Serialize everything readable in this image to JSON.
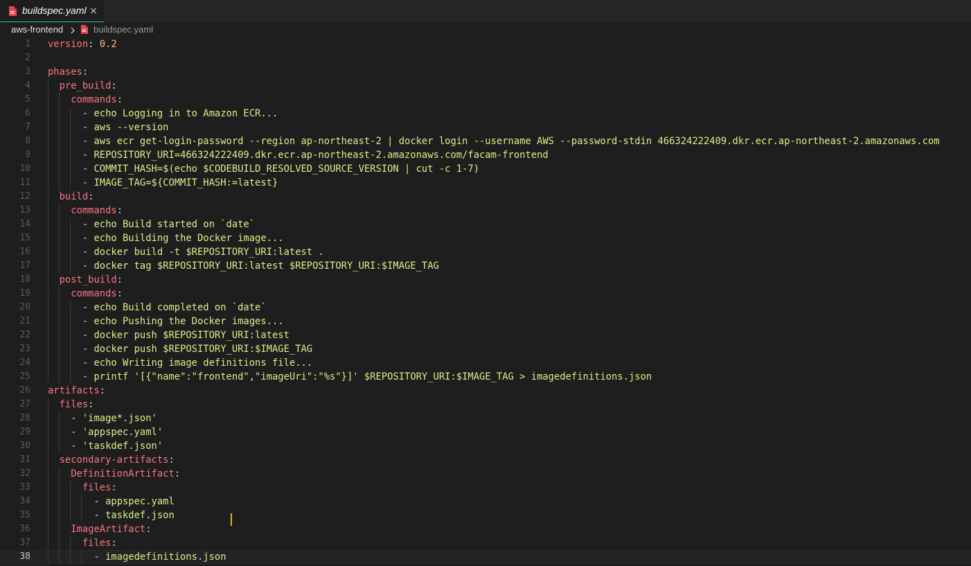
{
  "tab": {
    "label": "buildspec.yaml",
    "close_glyph": "×",
    "icon": "yaml-file-icon",
    "accent_color": "#2fb5ad"
  },
  "breadcrumb": {
    "folder": "aws-frontend",
    "separator_icon": "chevron-right-icon",
    "file_icon": "yaml-file-icon",
    "file": "buildspec.yaml"
  },
  "editor": {
    "current_line": 38,
    "colors": {
      "key": "#f97583",
      "value": "#d7f08a",
      "number": "#fab387",
      "cursor": "#f5a623"
    },
    "lines": [
      {
        "n": "1",
        "indent": "",
        "key": "version",
        "num": "0.2"
      },
      {
        "n": "2"
      },
      {
        "n": "3",
        "indent": "",
        "key": "phases"
      },
      {
        "n": "4",
        "indent": "  ",
        "key": "pre_build"
      },
      {
        "n": "5",
        "indent": "    ",
        "key": "commands"
      },
      {
        "n": "6",
        "indent": "      ",
        "dash": true,
        "value": "echo Logging in to Amazon ECR..."
      },
      {
        "n": "7",
        "indent": "      ",
        "dash": true,
        "value": "aws --version"
      },
      {
        "n": "8",
        "indent": "      ",
        "dash": true,
        "value": "aws ecr get-login-password --region ap-northeast-2 | docker login --username AWS --password-stdin 466324222409.dkr.ecr.ap-northeast-2.amazonaws.com"
      },
      {
        "n": "9",
        "indent": "      ",
        "dash": true,
        "value": "REPOSITORY_URI=466324222409.dkr.ecr.ap-northeast-2.amazonaws.com/facam-frontend"
      },
      {
        "n": "10",
        "indent": "      ",
        "dash": true,
        "value": "COMMIT_HASH=$(echo $CODEBUILD_RESOLVED_SOURCE_VERSION | cut -c 1-7)"
      },
      {
        "n": "11",
        "indent": "      ",
        "dash": true,
        "value": "IMAGE_TAG=${COMMIT_HASH:=latest}"
      },
      {
        "n": "12",
        "indent": "  ",
        "key": "build"
      },
      {
        "n": "13",
        "indent": "    ",
        "key": "commands"
      },
      {
        "n": "14",
        "indent": "      ",
        "dash": true,
        "value": "echo Build started on `date`"
      },
      {
        "n": "15",
        "indent": "      ",
        "dash": true,
        "value": "echo Building the Docker image..."
      },
      {
        "n": "16",
        "indent": "      ",
        "dash": true,
        "value": "docker build -t $REPOSITORY_URI:latest ."
      },
      {
        "n": "17",
        "indent": "      ",
        "dash": true,
        "value": "docker tag $REPOSITORY_URI:latest $REPOSITORY_URI:$IMAGE_TAG"
      },
      {
        "n": "18",
        "indent": "  ",
        "key": "post_build"
      },
      {
        "n": "19",
        "indent": "    ",
        "key": "commands"
      },
      {
        "n": "20",
        "indent": "      ",
        "dash": true,
        "value": "echo Build completed on `date`"
      },
      {
        "n": "21",
        "indent": "      ",
        "dash": true,
        "value": "echo Pushing the Docker images..."
      },
      {
        "n": "22",
        "indent": "      ",
        "dash": true,
        "value": "docker push $REPOSITORY_URI:latest"
      },
      {
        "n": "23",
        "indent": "      ",
        "dash": true,
        "value": "docker push $REPOSITORY_URI:$IMAGE_TAG"
      },
      {
        "n": "24",
        "indent": "      ",
        "dash": true,
        "value": "echo Writing image definitions file..."
      },
      {
        "n": "25",
        "indent": "      ",
        "dash": true,
        "value": "printf '[{\"name\":\"frontend\",\"imageUri\":\"%s\"}]' $REPOSITORY_URI:$IMAGE_TAG > imagedefinitions.json"
      },
      {
        "n": "26",
        "indent": "",
        "key": "artifacts"
      },
      {
        "n": "27",
        "indent": "  ",
        "key": "files"
      },
      {
        "n": "28",
        "indent": "    ",
        "dash": true,
        "value": "'image*.json'"
      },
      {
        "n": "29",
        "indent": "    ",
        "dash": true,
        "value": "'appspec.yaml'"
      },
      {
        "n": "30",
        "indent": "    ",
        "dash": true,
        "value": "'taskdef.json'"
      },
      {
        "n": "31",
        "indent": "  ",
        "key": "secondary-artifacts"
      },
      {
        "n": "32",
        "indent": "    ",
        "key": "DefinitionArtifact"
      },
      {
        "n": "33",
        "indent": "      ",
        "key": "files"
      },
      {
        "n": "34",
        "indent": "        ",
        "dash": true,
        "value": "appspec.yaml"
      },
      {
        "n": "35",
        "indent": "        ",
        "dash": true,
        "value": "taskdef.json"
      },
      {
        "n": "36",
        "indent": "    ",
        "key": "ImageArtifact"
      },
      {
        "n": "37",
        "indent": "      ",
        "key": "files"
      },
      {
        "n": "38",
        "indent": "        ",
        "dash": true,
        "value": "imagedefinitions.json"
      }
    ]
  }
}
